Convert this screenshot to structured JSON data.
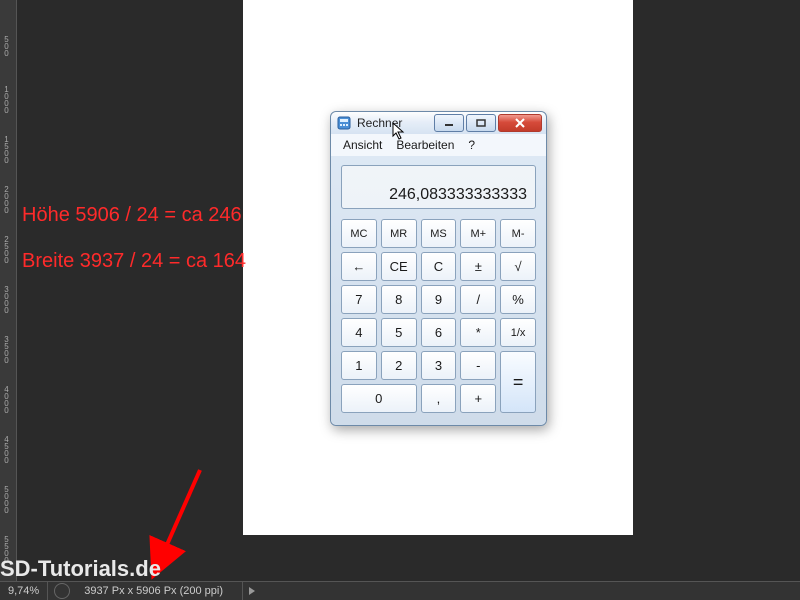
{
  "annotations": {
    "line1": "Höhe     5906 / 24  = ca 246",
    "line2": "Breite    3937 / 24 = ca 164"
  },
  "calculator": {
    "title": "Rechner",
    "menu": {
      "view": "Ansicht",
      "edit": "Bearbeiten",
      "help": "?"
    },
    "display": "246,083333333333",
    "keys": {
      "mc": "MC",
      "mr": "MR",
      "ms": "MS",
      "mplus": "M+",
      "mminus": "M-",
      "back": "←",
      "ce": "CE",
      "c": "C",
      "pm": "±",
      "sqrt": "√",
      "k7": "7",
      "k8": "8",
      "k9": "9",
      "div": "/",
      "pct": "%",
      "k4": "4",
      "k5": "5",
      "k6": "6",
      "mul": "*",
      "recip": "1/x",
      "k1": "1",
      "k2": "2",
      "k3": "3",
      "sub": "-",
      "eq": "=",
      "k0": "0",
      "dec": ",",
      "add": "+"
    }
  },
  "statusbar": {
    "zoom": "9,74%",
    "docinfo": "3937 Px x 5906 Px (200 ppi)"
  },
  "watermark": "SD-Tutorials.de",
  "ruler_labels": [
    "500",
    "1000",
    "1500",
    "2000",
    "2500",
    "3000",
    "3500",
    "4000",
    "4500",
    "5000",
    "5500"
  ],
  "colors": {
    "annotation": "#ff2a2a",
    "arrow": "#ff0000"
  }
}
